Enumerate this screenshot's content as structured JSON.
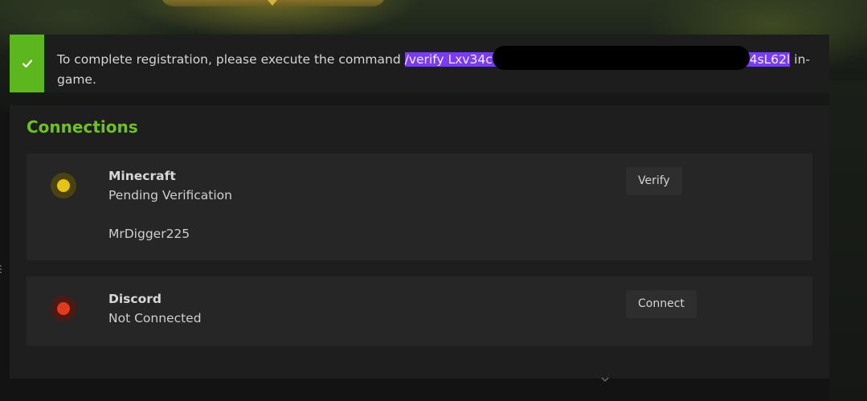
{
  "alert": {
    "icon": "check-icon",
    "accent_color": "#5cb71e",
    "text_before": "To complete registration, please execute the command ",
    "command_start": "/verify Lxv34c",
    "command_end": "4sL62l",
    "text_after": " in-game."
  },
  "connections": {
    "title": "Connections",
    "title_color": "#6ec21c",
    "items": [
      {
        "name": "Minecraft",
        "status": "Pending Verification",
        "status_color": "#e6c416",
        "username": "MrDigger225",
        "action_label": "Verify"
      },
      {
        "name": "Discord",
        "status": "Not Connected",
        "status_color": "#e23a1e",
        "action_label": "Connect"
      }
    ]
  }
}
